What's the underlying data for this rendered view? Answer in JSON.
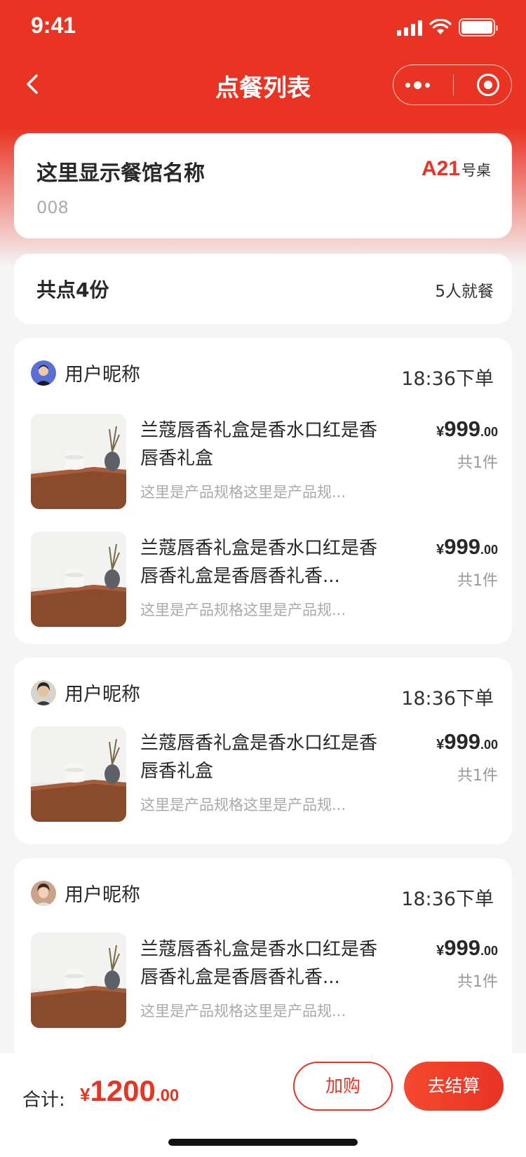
{
  "status_bar": {
    "time": "9:41"
  },
  "nav": {
    "title": "点餐列表"
  },
  "restaurant": {
    "name": "这里显示餐馆名称",
    "code": "008",
    "table_number": "A21",
    "table_suffix": "号桌"
  },
  "summary": {
    "total_items": "共点4份",
    "diners": "5人就餐"
  },
  "orders": [
    {
      "nickname": "用户昵称",
      "time": "18:36下单",
      "items": [
        {
          "name": "兰蔻唇香礼盒是香水口红是香唇香礼盒",
          "spec": "这里是产品规格这里是产品规...",
          "price_symbol": "¥",
          "price_int": "999",
          "price_dec": ".00",
          "count": "共1件"
        },
        {
          "name": "兰蔻唇香礼盒是香水口红是香唇香礼盒是香唇香礼香...",
          "spec": "这里是产品规格这里是产品规...",
          "price_symbol": "¥",
          "price_int": "999",
          "price_dec": ".00",
          "count": "共1件"
        }
      ]
    },
    {
      "nickname": "用户昵称",
      "time": "18:36下单",
      "items": [
        {
          "name": "兰蔻唇香礼盒是香水口红是香唇香礼盒",
          "spec": "这里是产品规格这里是产品规...",
          "price_symbol": "¥",
          "price_int": "999",
          "price_dec": ".00",
          "count": "共1件"
        }
      ]
    },
    {
      "nickname": "用户昵称",
      "time": "18:36下单",
      "items": [
        {
          "name": "兰蔻唇香礼盒是香水口红是香唇香礼盒是香唇香礼香...",
          "spec": "这里是产品规格这里是产品规...",
          "price_symbol": "¥",
          "price_int": "999",
          "price_dec": ".00",
          "count": "共1件"
        }
      ]
    }
  ],
  "footer": {
    "total_label": "合计:",
    "total_symbol": "¥",
    "total_int": "1200",
    "total_dec": ".00",
    "add_label": "加购",
    "checkout_label": "去结算"
  },
  "colors": {
    "accent": "#e93323",
    "background": "#f5f5f5"
  },
  "icons": {
    "back": "chevron-left-icon",
    "more": "more-dots-icon",
    "close": "target-close-icon"
  }
}
